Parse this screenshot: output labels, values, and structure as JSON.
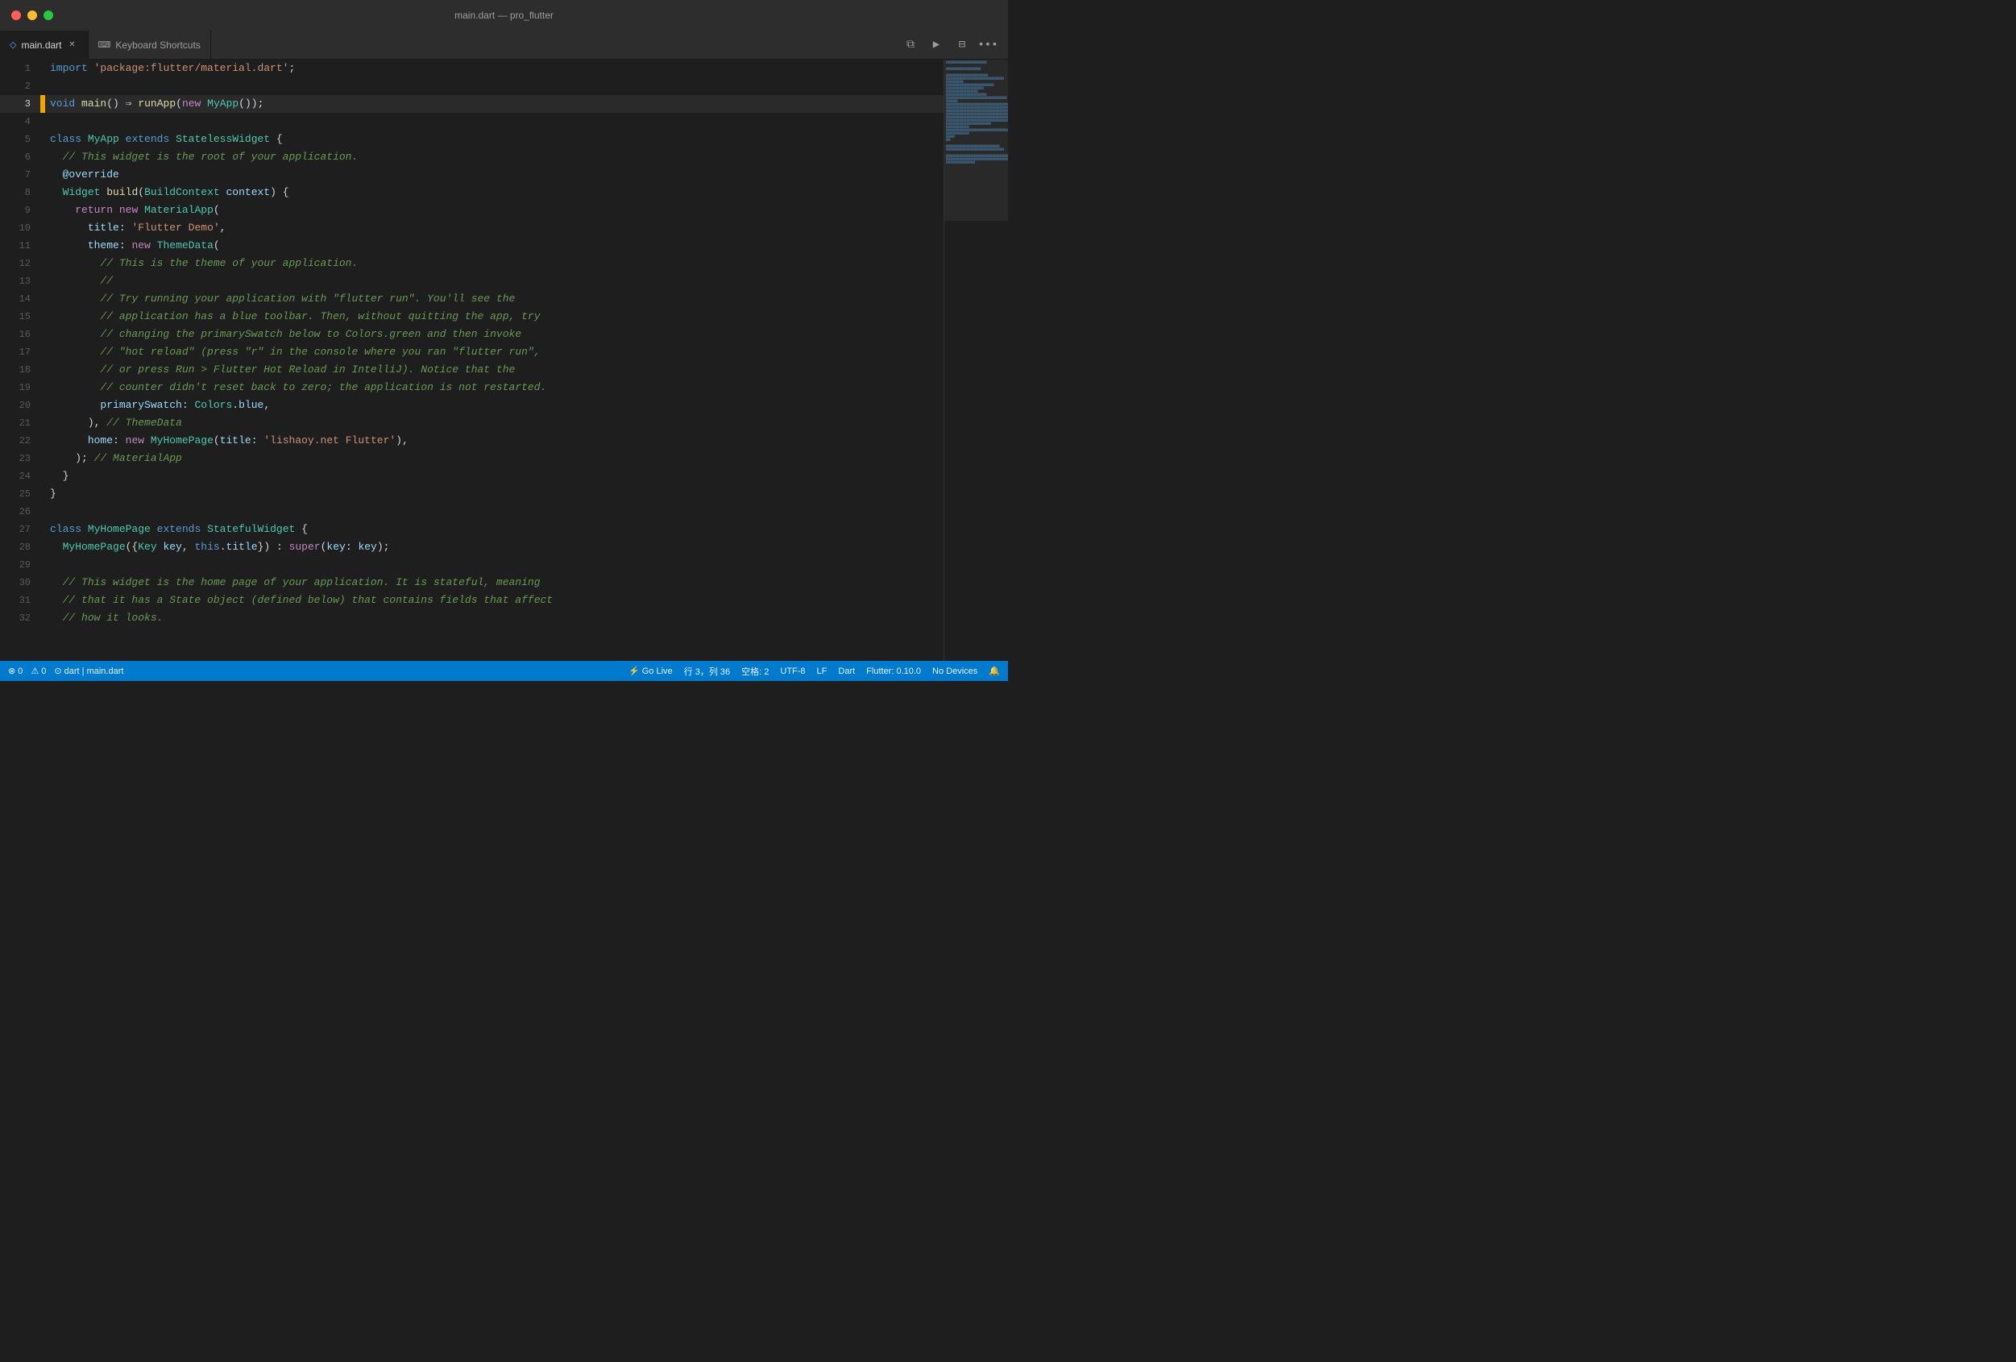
{
  "window": {
    "title": "main.dart — pro_flutter"
  },
  "tabs": [
    {
      "id": "main-dart",
      "label": "main.dart",
      "icon": "◇",
      "active": true,
      "closable": true
    },
    {
      "id": "keyboard-shortcuts",
      "label": "Keyboard Shortcuts",
      "icon": "⌨",
      "active": false,
      "closable": false
    }
  ],
  "toolbar": {
    "buttons": [
      "◄►",
      "▶",
      "⊞",
      "•••"
    ]
  },
  "code": {
    "lines": [
      {
        "num": 1,
        "content": "import 'package:flutter/material.dart';",
        "active": false
      },
      {
        "num": 2,
        "content": "",
        "active": false
      },
      {
        "num": 3,
        "content": "void main() ⇒ runApp(new MyApp());",
        "active": true
      },
      {
        "num": 4,
        "content": "",
        "active": false
      },
      {
        "num": 5,
        "content": "class MyApp extends StatelessWidget {",
        "active": false
      },
      {
        "num": 6,
        "content": "  // This widget is the root of your application.",
        "active": false
      },
      {
        "num": 7,
        "content": "  @override",
        "active": false
      },
      {
        "num": 8,
        "content": "  Widget build(BuildContext context) {",
        "active": false
      },
      {
        "num": 9,
        "content": "    return new MaterialApp(",
        "active": false
      },
      {
        "num": 10,
        "content": "      title: 'Flutter Demo',",
        "active": false
      },
      {
        "num": 11,
        "content": "      theme: new ThemeData(",
        "active": false
      },
      {
        "num": 12,
        "content": "        // This is the theme of your application.",
        "active": false
      },
      {
        "num": 13,
        "content": "        //",
        "active": false
      },
      {
        "num": 14,
        "content": "        // Try running your application with \"flutter run\". You'll see the",
        "active": false
      },
      {
        "num": 15,
        "content": "        // application has a blue toolbar. Then, without quitting the app, try",
        "active": false
      },
      {
        "num": 16,
        "content": "        // changing the primarySwatch below to Colors.green and then invoke",
        "active": false
      },
      {
        "num": 17,
        "content": "        // \"hot reload\" (press \"r\" in the console where you ran \"flutter run\",",
        "active": false
      },
      {
        "num": 18,
        "content": "        // or press Run > Flutter Hot Reload in IntelliJ). Notice that the",
        "active": false
      },
      {
        "num": 19,
        "content": "        // counter didn't reset back to zero; the application is not restarted.",
        "active": false
      },
      {
        "num": 20,
        "content": "        primarySwatch: Colors.blue,",
        "active": false
      },
      {
        "num": 21,
        "content": "      ), // ThemeData",
        "active": false
      },
      {
        "num": 22,
        "content": "      home: new MyHomePage(title: 'lishaoy.net Flutter'),",
        "active": false
      },
      {
        "num": 23,
        "content": "    ); // MaterialApp",
        "active": false
      },
      {
        "num": 24,
        "content": "  }",
        "active": false
      },
      {
        "num": 25,
        "content": "}",
        "active": false
      },
      {
        "num": 26,
        "content": "",
        "active": false
      },
      {
        "num": 27,
        "content": "class MyHomePage extends StatefulWidget {",
        "active": false
      },
      {
        "num": 28,
        "content": "  MyHomePage({Key key, this.title}) : super(key: key);",
        "active": false
      },
      {
        "num": 29,
        "content": "",
        "active": false
      },
      {
        "num": 30,
        "content": "  // This widget is the home page of your application. It is stateful, meaning",
        "active": false
      },
      {
        "num": 31,
        "content": "  // that it has a State object (defined below) that contains fields that affect",
        "active": false
      },
      {
        "num": 32,
        "content": "  // how it looks.",
        "active": false
      }
    ]
  },
  "status_bar": {
    "errors": "0",
    "warnings": "0",
    "git_icon": "⊙",
    "git_branch": "dart",
    "file_info": "main.dart",
    "go_live": "⚡ Go Live",
    "position": "行 3，列 36",
    "spaces": "空格: 2",
    "encoding": "UTF-8",
    "line_ending": "LF",
    "language": "Dart",
    "sdk": "Flutter: 0.10.0",
    "devices": "No Devices",
    "bell_icon": "🔔"
  }
}
